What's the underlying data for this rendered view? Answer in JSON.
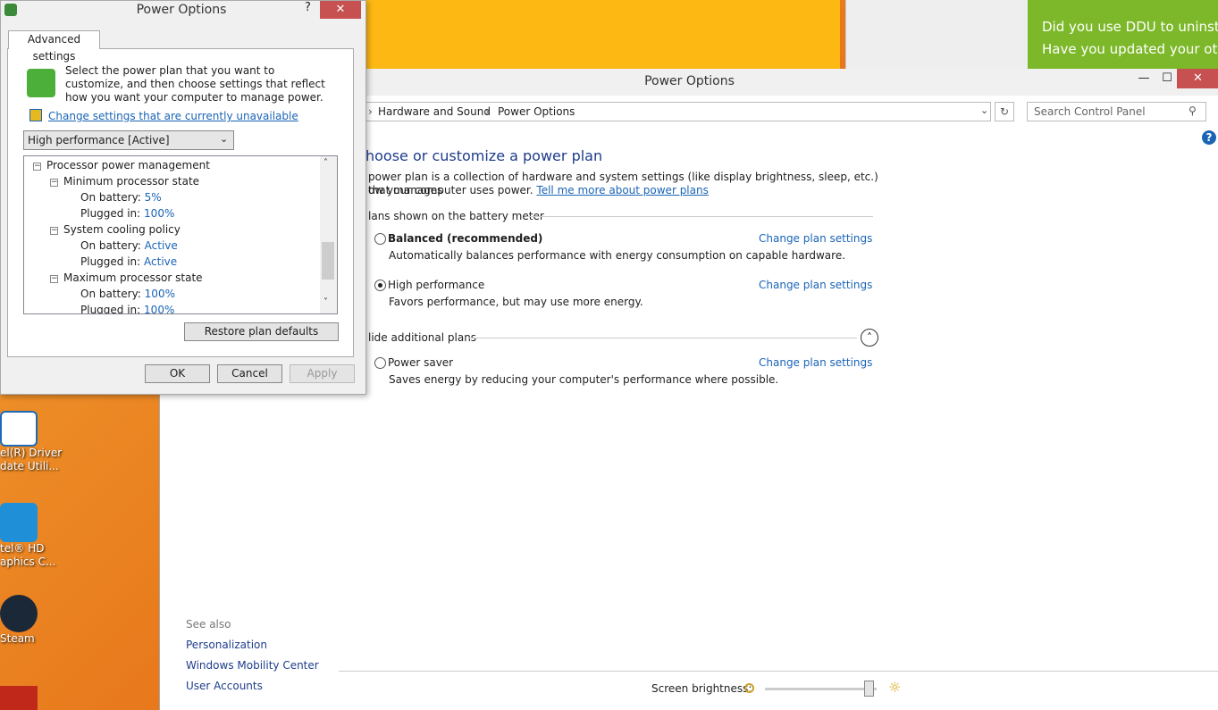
{
  "desktop": {
    "icons": [
      {
        "label1": "el(R) Driver",
        "label2": "date Utili..."
      },
      {
        "label1": "tel® HD",
        "label2": "aphics C..."
      },
      {
        "label1": "Steam",
        "label2": ""
      }
    ]
  },
  "background": {
    "green_lines": [
      "Did you use DDU to uninstal",
      "Have you updated your othe"
    ]
  },
  "dialog": {
    "title": "Power Options",
    "help": "?",
    "close": "✕",
    "tab": "Advanced settings",
    "description": "Select the power plan that you want to customize, and then choose settings that reflect how you want your computer to manage power.",
    "change_link": "Change settings that are currently unavailable",
    "plan_selected": "High performance [Active]",
    "tree": {
      "root": "Processor power management",
      "groups": [
        {
          "name": "Minimum processor state",
          "battery_label": "On battery:",
          "battery": "5%",
          "plugged_label": "Plugged in:",
          "plugged": "100%"
        },
        {
          "name": "System cooling policy",
          "battery_label": "On battery:",
          "battery": "Active",
          "plugged_label": "Plugged in:",
          "plugged": "Active"
        },
        {
          "name": "Maximum processor state",
          "battery_label": "On battery:",
          "battery": "100%",
          "plugged_label": "Plugged in:",
          "plugged": "100%"
        }
      ]
    },
    "restore_btn": "Restore plan defaults",
    "ok": "OK",
    "cancel": "Cancel",
    "apply": "Apply"
  },
  "cp": {
    "title": "Power Options",
    "min": "—",
    "max": "☐",
    "close": "✕",
    "breadcrumb": [
      "Hardware and Sound",
      "Power Options"
    ],
    "search_placeholder": "Search Control Panel",
    "heading": "hoose or customize a power plan",
    "intro1": "power plan is a collection of hardware and system settings (like display brightness, sleep, etc.) that manages",
    "intro2": "ow your computer uses power.",
    "intro_link": "Tell me more about power plans",
    "section1": "lans shown on the battery meter",
    "plans": [
      {
        "name": "Balanced (recommended)",
        "desc": "Automatically balances performance with energy consumption on capable hardware.",
        "link": "Change plan settings",
        "selected": false
      },
      {
        "name": "High performance",
        "desc": "Favors performance, but may use more energy.",
        "link": "Change plan settings",
        "selected": true
      }
    ],
    "section2": "lide additional plans",
    "extra_plan": {
      "name": "Power saver",
      "desc": "Saves energy by reducing your computer's performance where possible.",
      "link": "Change plan settings",
      "selected": false
    },
    "see_also": "See also",
    "see_also_links": [
      "Personalization",
      "Windows Mobility Center",
      "User Accounts"
    ],
    "brightness_label": "Screen brightness:",
    "brightness_level": 0.97
  },
  "colors": {
    "link": "#1a64b6",
    "heading": "#1e3c8c",
    "close": "#c75050",
    "green": "#7cb829",
    "yellow": "#fdb813"
  }
}
